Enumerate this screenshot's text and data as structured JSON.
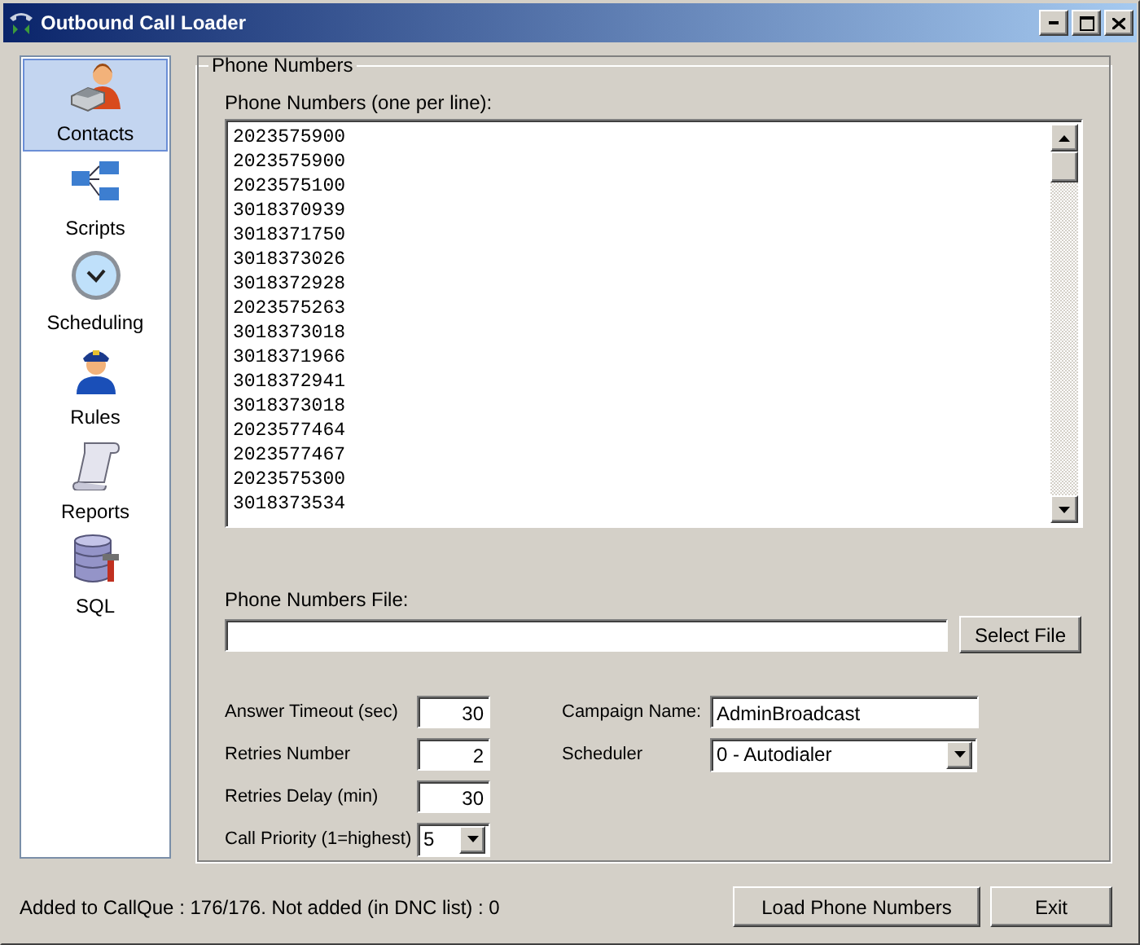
{
  "window": {
    "title": "Outbound Call Loader"
  },
  "sidebar": {
    "items": [
      {
        "label": "Contacts",
        "kind": "contacts",
        "selected": true
      },
      {
        "label": "Scripts",
        "kind": "scripts",
        "selected": false
      },
      {
        "label": "Scheduling",
        "kind": "clock",
        "selected": false
      },
      {
        "label": "Rules",
        "kind": "officer",
        "selected": false
      },
      {
        "label": "Reports",
        "kind": "scroll",
        "selected": false
      },
      {
        "label": "SQL",
        "kind": "database",
        "selected": false
      }
    ]
  },
  "group": {
    "title": "Phone Numbers"
  },
  "phone_list": {
    "label": "Phone Numbers (one per line):",
    "lines": [
      "2023575900",
      "2023575900",
      "2023575100",
      "3018370939",
      "3018371750",
      "3018373026",
      "3018372928",
      "2023575263",
      "3018373018",
      "3018371966",
      "3018372941",
      "3018373018",
      "2023577464",
      "2023577467",
      "2023575300",
      "3018373534"
    ]
  },
  "file": {
    "label": "Phone Numbers File:",
    "button": "Select File"
  },
  "settings": [
    {
      "kind": "number",
      "label": "Answer Timeout (sec)",
      "value": "30"
    },
    {
      "kind": "number",
      "label": "Retries Number",
      "value": "2"
    },
    {
      "kind": "number",
      "label": "Retries Delay (min)",
      "value": "30"
    },
    {
      "kind": "dropdown",
      "label": "Call Priority (1=highest)",
      "value": "5"
    }
  ],
  "campaign": [
    {
      "kind": "text",
      "label": "Campaign Name:",
      "value": "AdminBroadcast"
    },
    {
      "kind": "dropdown",
      "label": "Scheduler",
      "value": "0 - Autodialer"
    }
  ],
  "status": "Added to CallQue : 176/176. Not added (in DNC list) : 0",
  "buttons": [
    "Load Phone Numbers",
    "Exit"
  ]
}
